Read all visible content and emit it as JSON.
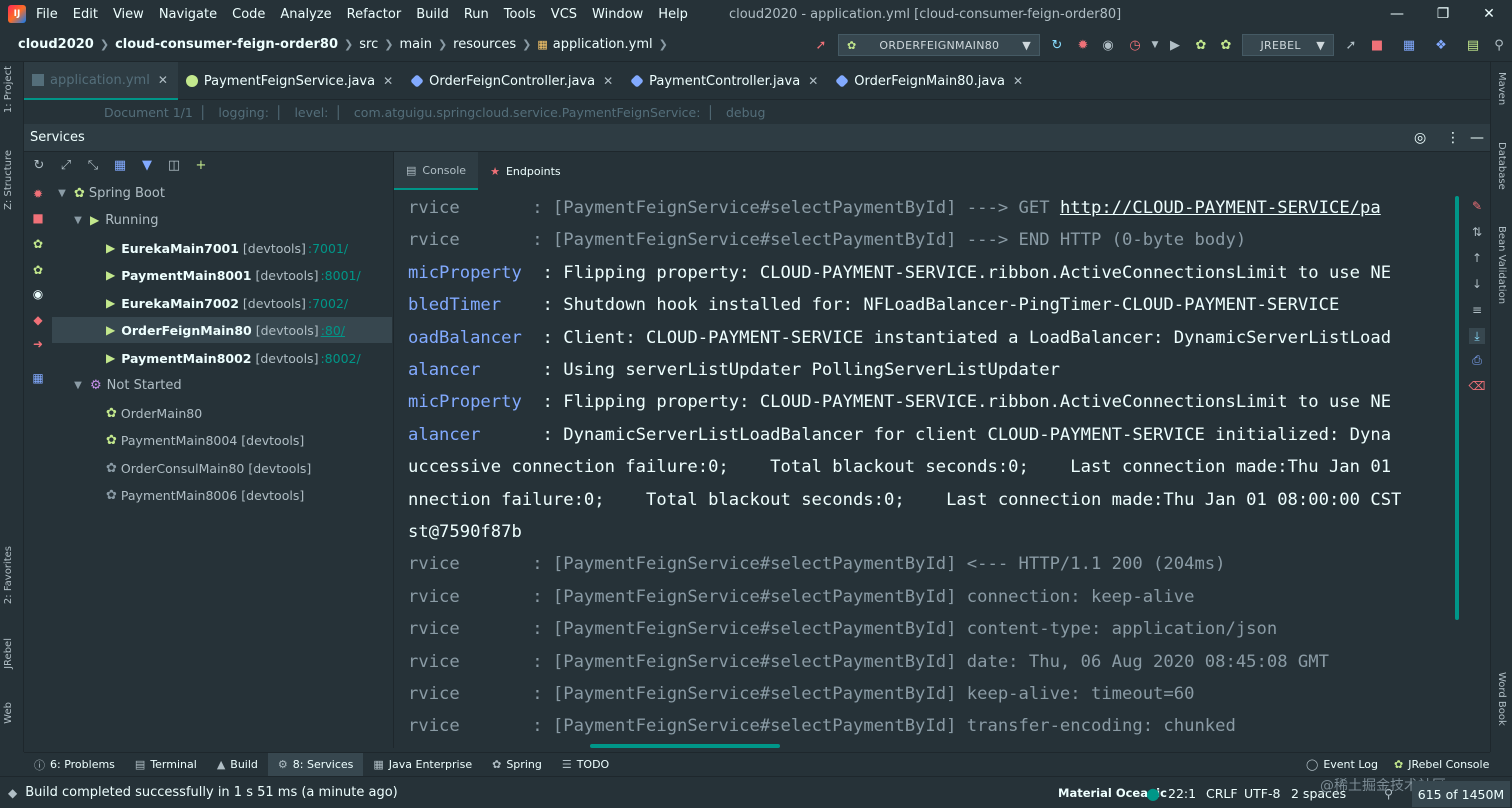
{
  "menubar": {
    "items": [
      "File",
      "Edit",
      "View",
      "Navigate",
      "Code",
      "Analyze",
      "Refactor",
      "Build",
      "Run",
      "Tools",
      "VCS",
      "Window",
      "Help"
    ],
    "window_title": "cloud2020 - application.yml [cloud-consumer-feign-order80]"
  },
  "navbar": {
    "crumbs": [
      "cloud2020",
      "cloud-consumer-feign-order80",
      "src",
      "main",
      "resources",
      "application.yml"
    ],
    "run_config": "ORDERFEIGNMAIN80",
    "jrebel": "JREBEL"
  },
  "tabs": [
    {
      "label": "application.yml",
      "active": true
    },
    {
      "label": "PaymentFeignService.java",
      "active": false
    },
    {
      "label": "OrderFeignController.java",
      "active": false
    },
    {
      "label": "PaymentController.java",
      "active": false
    },
    {
      "label": "OrderFeignMain80.java",
      "active": false
    }
  ],
  "editor_crumbs": [
    "Document 1/1",
    "logging:",
    "level:",
    "com.atguigu.springcloud.service.PaymentFeignService:",
    "debug"
  ],
  "services": {
    "title": "Services",
    "group_spring_boot": "Spring Boot",
    "group_running": "Running",
    "running": [
      {
        "name": "EurekaMain7001",
        "dev": "[devtools]",
        "port": ":7001/"
      },
      {
        "name": "PaymentMain8001",
        "dev": "[devtools]",
        "port": ":8001/"
      },
      {
        "name": "EurekaMain7002",
        "dev": "[devtools]",
        "port": ":7002/"
      },
      {
        "name": "OrderFeignMain80",
        "dev": "[devtools]",
        "port": ":80/"
      },
      {
        "name": "PaymentMain8002",
        "dev": "[devtools]",
        "port": ":8002/"
      }
    ],
    "group_not_started": "Not Started",
    "not_started": [
      "OrderMain80",
      "PaymentMain8004 [devtools]",
      "OrderConsulMain80 [devtools]",
      "PaymentMain8006 [devtools]"
    ]
  },
  "console": {
    "tab_console": "Console",
    "tab_endpoints": "Endpoints",
    "lines": [
      {
        "logger": "rvice       ",
        "text": ": [PaymentFeignService#selectPaymentById] ---> GET ",
        "url": "http://CLOUD-PAYMENT-SERVICE/pa",
        "dim": true
      },
      {
        "logger": "rvice       ",
        "text": ": [PaymentFeignService#selectPaymentById] ---> END HTTP (0-byte body)",
        "url": "",
        "dim": true
      },
      {
        "logger": "micProperty ",
        "text": " : Flipping property: CLOUD-PAYMENT-SERVICE.ribbon.ActiveConnectionsLimit to use NE",
        "url": "",
        "dim": false
      },
      {
        "logger": "bledTimer   ",
        "text": " : Shutdown hook installed for: NFLoadBalancer-PingTimer-CLOUD-PAYMENT-SERVICE",
        "url": "",
        "dim": false
      },
      {
        "logger": "oadBalancer ",
        "text": " : Client: CLOUD-PAYMENT-SERVICE instantiated a LoadBalancer: DynamicServerListLoad",
        "url": "",
        "dim": false
      },
      {
        "logger": "alancer     ",
        "text": " : Using serverListUpdater PollingServerListUpdater",
        "url": "",
        "dim": false
      },
      {
        "logger": "micProperty ",
        "text": " : Flipping property: CLOUD-PAYMENT-SERVICE.ribbon.ActiveConnectionsLimit to use NE",
        "url": "",
        "dim": false
      },
      {
        "logger": "alancer     ",
        "text": " : DynamicServerListLoadBalancer for client CLOUD-PAYMENT-SERVICE initialized: Dyna",
        "url": "",
        "dim": false
      },
      {
        "logger": "",
        "text": "uccessive connection failure:0;    Total blackout seconds:0;    Last connection made:Thu Jan 01",
        "url": "",
        "dim": false
      },
      {
        "logger": "",
        "text": "nnection failure:0;    Total blackout seconds:0;    Last connection made:Thu Jan 01 08:00:00 CST",
        "url": "",
        "dim": false
      },
      {
        "logger": "",
        "text": "st@7590f87b",
        "url": "",
        "dim": false
      },
      {
        "logger": "rvice       ",
        "text": ": [PaymentFeignService#selectPaymentById] <--- HTTP/1.1 200 (204ms)",
        "url": "",
        "dim": true
      },
      {
        "logger": "rvice       ",
        "text": ": [PaymentFeignService#selectPaymentById] connection: keep-alive",
        "url": "",
        "dim": true
      },
      {
        "logger": "rvice       ",
        "text": ": [PaymentFeignService#selectPaymentById] content-type: application/json",
        "url": "",
        "dim": true
      },
      {
        "logger": "rvice       ",
        "text": ": [PaymentFeignService#selectPaymentById] date: Thu, 06 Aug 2020 08:45:08 GMT",
        "url": "",
        "dim": true
      },
      {
        "logger": "rvice       ",
        "text": ": [PaymentFeignService#selectPaymentById] keep-alive: timeout=60",
        "url": "",
        "dim": true
      },
      {
        "logger": "rvice       ",
        "text": ": [PaymentFeignService#selectPaymentById] transfer-encoding: chunked",
        "url": "",
        "dim": true
      }
    ]
  },
  "left_stripe": {
    "project": "1: Project",
    "structure": "Z: Structure",
    "favorites": "2: Favorites",
    "jrebel": "JRebel",
    "web": "Web"
  },
  "right_stripe": {
    "maven": "Maven",
    "database": "Database",
    "bean": "Bean Validation",
    "wordbook": "Word Book"
  },
  "bottom_tools": [
    {
      "label": "6: Problems",
      "icon": "warning-icon",
      "active": false
    },
    {
      "label": "Terminal",
      "icon": "terminal-icon",
      "active": false
    },
    {
      "label": "Build",
      "icon": "build-icon",
      "active": false
    },
    {
      "label": "8: Services",
      "icon": "services-icon",
      "active": true
    },
    {
      "label": "Java Enterprise",
      "icon": "enterprise-icon",
      "active": false
    },
    {
      "label": "Spring",
      "icon": "spring-icon",
      "active": false
    },
    {
      "label": "TODO",
      "icon": "todo-icon",
      "active": false
    }
  ],
  "bottom_right_tools": {
    "event_log": "Event Log",
    "jrebel_console": "JRebel Console"
  },
  "status": {
    "message": "Build completed successfully in 1 s 51 ms (a minute ago)",
    "theme": "Material Oceanic",
    "position": "22:1",
    "line_sep": "CRLF",
    "encoding": "UTF-8",
    "indent": "2 spaces",
    "memory": "615 of 1450M",
    "watermark": "@稀土掘金技术社区"
  },
  "colors": {
    "accent": "#009688",
    "bg": "#263238",
    "running": "#c3e88d",
    "stop": "#f07178"
  }
}
